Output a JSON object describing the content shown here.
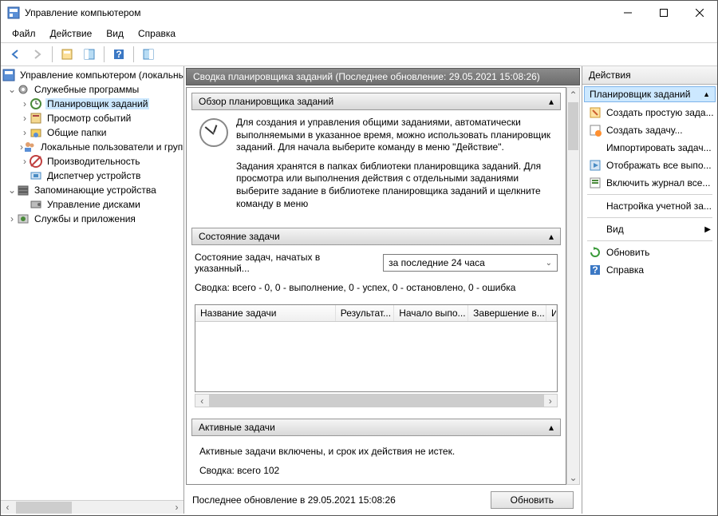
{
  "window": {
    "title": "Управление компьютером"
  },
  "menubar": {
    "file": "Файл",
    "action": "Действие",
    "view": "Вид",
    "help": "Справка"
  },
  "tree": {
    "root": "Управление компьютером (локальный",
    "system_tools": "Служебные программы",
    "task_scheduler": "Планировщик заданий",
    "event_viewer": "Просмотр событий",
    "shared_folders": "Общие папки",
    "local_users": "Локальные пользователи и группы",
    "performance": "Производительность",
    "device_manager": "Диспетчер устройств",
    "storage": "Запоминающие устройства",
    "disk_management": "Управление дисками",
    "services_apps": "Службы и приложения"
  },
  "center": {
    "summary_title": "Сводка планировщика заданий (Последнее обновление: 29.05.2021 15:08:26)",
    "overview_header": "Обзор планировщика заданий",
    "overview_p1": "Для создания и управления общими заданиями, автоматически выполняемыми в указанное время, можно использовать планировщик заданий. Для начала выберите команду в меню \"Действие\".",
    "overview_p2": "Задания хранятся в папках библиотеки планировщика заданий. Для просмотра или выполнения действия с отдельными заданиями выберите задание в библиотеке планировщика заданий и щелкните команду в меню",
    "status_header": "Состояние задачи",
    "status_label": "Состояние задач, начатых в указанный...",
    "status_dropdown": "за последние 24 часа",
    "status_summary": "Сводка: всего - 0, 0 - выполнение, 0 - успех, 0 - остановлено, 0 - ошибка",
    "table": {
      "name": "Название задачи",
      "result": "Результат...",
      "start": "Начало выпо...",
      "end": "Завершение в...",
      "init": "И"
    },
    "active_header": "Активные задачи",
    "active_desc": "Активные задачи включены, и срок их действия не истек.",
    "active_summary": "Сводка: всего 102",
    "footer_text": "Последнее обновление в 29.05.2021 15:08:26",
    "refresh_btn": "Обновить"
  },
  "actions": {
    "title": "Действия",
    "subtitle": "Планировщик заданий",
    "create_basic": "Создать простую зада...",
    "create_task": "Создать задачу...",
    "import_task": "Импортировать задач...",
    "show_running": "Отображать все выпо...",
    "enable_history": "Включить журнал все...",
    "account_config": "Настройка учетной за...",
    "view": "Вид",
    "refresh": "Обновить",
    "help": "Справка"
  }
}
